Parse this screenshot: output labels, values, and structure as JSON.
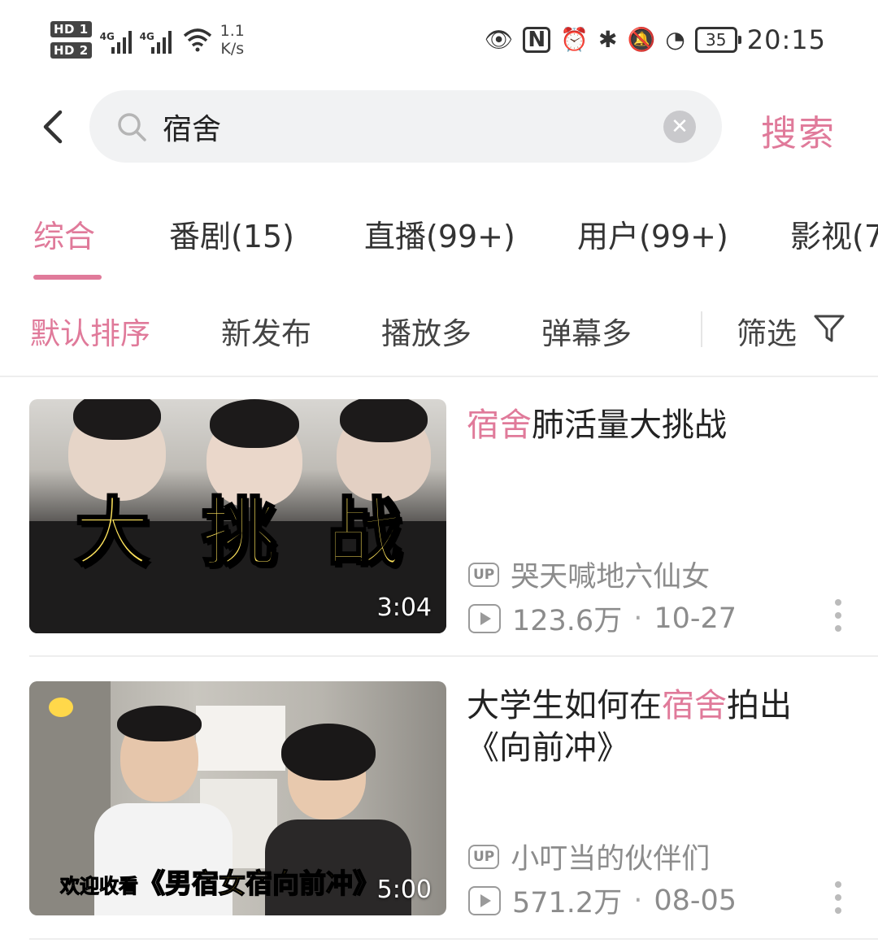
{
  "status_bar": {
    "sim1": "HD 1",
    "sim2": "HD 2",
    "network1": "4G",
    "network2": "4G",
    "speed_value": "1.1",
    "speed_unit": "K/s",
    "battery": "35",
    "time": "20:15"
  },
  "search": {
    "query": "宿舍",
    "button_label": "搜索"
  },
  "tabs": [
    {
      "label": "综合"
    },
    {
      "label": "番剧(15)"
    },
    {
      "label": "直播(99+)"
    },
    {
      "label": "用户(99+)"
    },
    {
      "label": "影视(7"
    }
  ],
  "sort": {
    "options": [
      "默认排序",
      "新发布",
      "播放多",
      "弹幕多"
    ],
    "filter_label": "筛选"
  },
  "results": [
    {
      "title_highlight": "宿舍",
      "title_rest": "肺活量大挑战",
      "title_pre": "",
      "title_line2": "",
      "uploader": "哭天喊地六仙女",
      "views": "123.6万",
      "date": "10-27",
      "duration": "3:04",
      "thumb_text": [
        "大",
        "挑",
        "战"
      ]
    },
    {
      "title_pre": "大学生如何在",
      "title_highlight": "宿舍",
      "title_rest": "拍出",
      "title_line2": "《向前冲》",
      "uploader": "小叮当的伙伴们",
      "views": "571.2万",
      "date": "08-05",
      "duration": "5:00",
      "thumb_caption_small": "欢迎收看",
      "thumb_caption_big": "《男宿女宿向前冲》"
    }
  ],
  "colors": {
    "accent": "#e07a9a",
    "meta_gray": "#8c8c8c"
  }
}
